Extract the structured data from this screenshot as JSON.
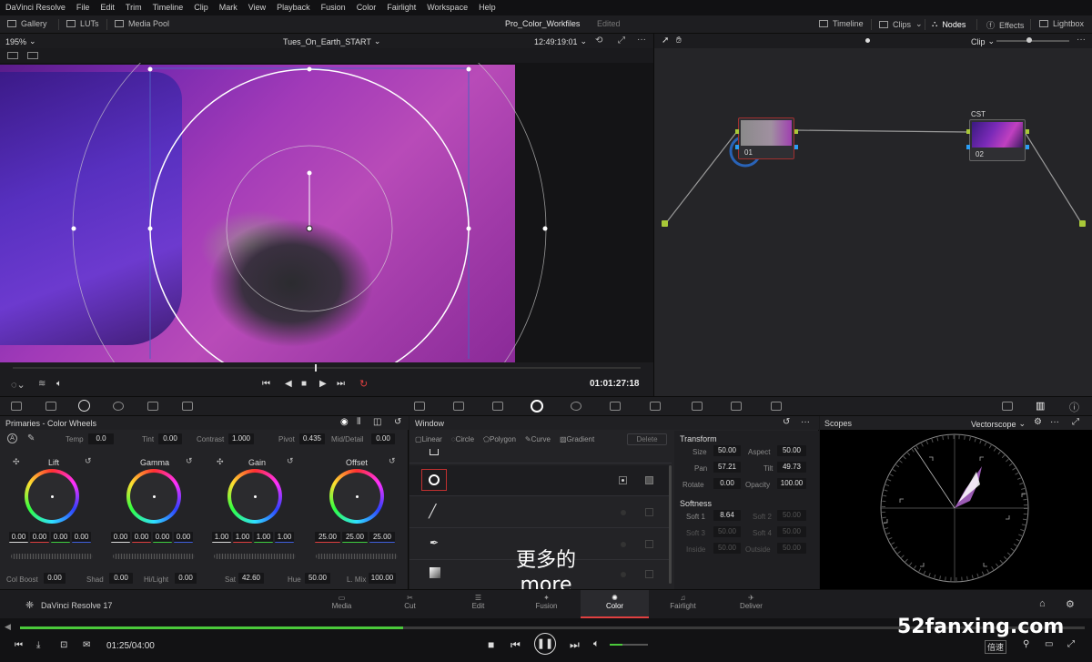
{
  "menu": {
    "items": [
      "DaVinci Resolve",
      "File",
      "Edit",
      "Trim",
      "Timeline",
      "Clip",
      "Mark",
      "View",
      "Playback",
      "Fusion",
      "Color",
      "Fairlight",
      "Workspace",
      "Help"
    ]
  },
  "topbar": {
    "gallery": "Gallery",
    "luts": "LUTs",
    "media_pool": "Media Pool",
    "project_title": "Pro_Color_Workfiles",
    "project_status": "Edited",
    "timeline": "Timeline",
    "clips": "Clips",
    "nodes": "Nodes",
    "effects": "Effects",
    "lightbox": "Lightbox"
  },
  "viewer": {
    "zoom": "195%",
    "clip_name": "Tues_On_Earth_START",
    "timecode_top": "12:49:19:01",
    "timecode": "01:01:27:18"
  },
  "node_editor": {
    "mode": "Clip",
    "node1_label": "01",
    "node2_title": "CST",
    "node2_label": "02"
  },
  "primaries": {
    "title": "Primaries - Color Wheels",
    "temp_label": "Temp",
    "temp": "0.0",
    "tint_label": "Tint",
    "tint": "0.00",
    "contrast_label": "Contrast",
    "contrast": "1.000",
    "pivot_label": "Pivot",
    "pivot": "0.435",
    "middetail_label": "Mid/Detail",
    "middetail": "0.00",
    "wheels": [
      {
        "name": "Lift",
        "values": [
          "0.00",
          "0.00",
          "0.00",
          "0.00"
        ]
      },
      {
        "name": "Gamma",
        "values": [
          "0.00",
          "0.00",
          "0.00",
          "0.00"
        ]
      },
      {
        "name": "Gain",
        "values": [
          "1.00",
          "1.00",
          "1.00",
          "1.00"
        ]
      },
      {
        "name": "Offset",
        "values": [
          "25.00",
          "25.00",
          "25.00"
        ]
      }
    ],
    "colboost_label": "Col Boost",
    "colboost": "0.00",
    "shad_label": "Shad",
    "shad": "0.00",
    "hilight_label": "Hi/Light",
    "hilight": "0.00",
    "sat_label": "Sat",
    "sat": "42.60",
    "hue_label": "Hue",
    "hue": "50.00",
    "lmix_label": "L. Mix",
    "lmix": "100.00"
  },
  "window_panel": {
    "title": "Window",
    "tools": [
      "Linear",
      "Circle",
      "Polygon",
      "Curve",
      "Gradient"
    ],
    "delete": "Delete",
    "transform_title": "Transform",
    "size_label": "Size",
    "size": "50.00",
    "aspect_label": "Aspect",
    "aspect": "50.00",
    "pan_label": "Pan",
    "pan": "57.21",
    "tilt_label": "Tilt",
    "tilt": "49.73",
    "rotate_label": "Rotate",
    "rotate": "0.00",
    "opacity_label": "Opacity",
    "opacity": "100.00",
    "softness_title": "Softness",
    "soft1_label": "Soft 1",
    "soft1": "8.64",
    "soft2_label": "Soft 2",
    "soft2": "50.00",
    "soft3_label": "Soft 3",
    "soft3": "50.00",
    "soft4_label": "Soft 4",
    "soft4": "50.00",
    "inside_label": "Inside",
    "inside": "50.00",
    "outside_label": "Outside",
    "outside": "50.00"
  },
  "scopes": {
    "title": "Scopes",
    "mode": "Vectorscope"
  },
  "pagenav": {
    "app": "DaVinci Resolve 17",
    "pages": [
      "Media",
      "Cut",
      "Edit",
      "Fusion",
      "Color",
      "Fairlight",
      "Deliver"
    ],
    "active": "Color"
  },
  "player": {
    "time": "01:25/04:00",
    "speed": "倍速",
    "progress": 0.36
  },
  "subtitle": {
    "zh": "更多的",
    "en": "more"
  },
  "watermark": "52fanxing.com",
  "colors": {
    "accent_red": "#e04040",
    "progress_green": "#4bc93b",
    "node_blue": "#2a9df4",
    "node_green": "#a8c838"
  }
}
